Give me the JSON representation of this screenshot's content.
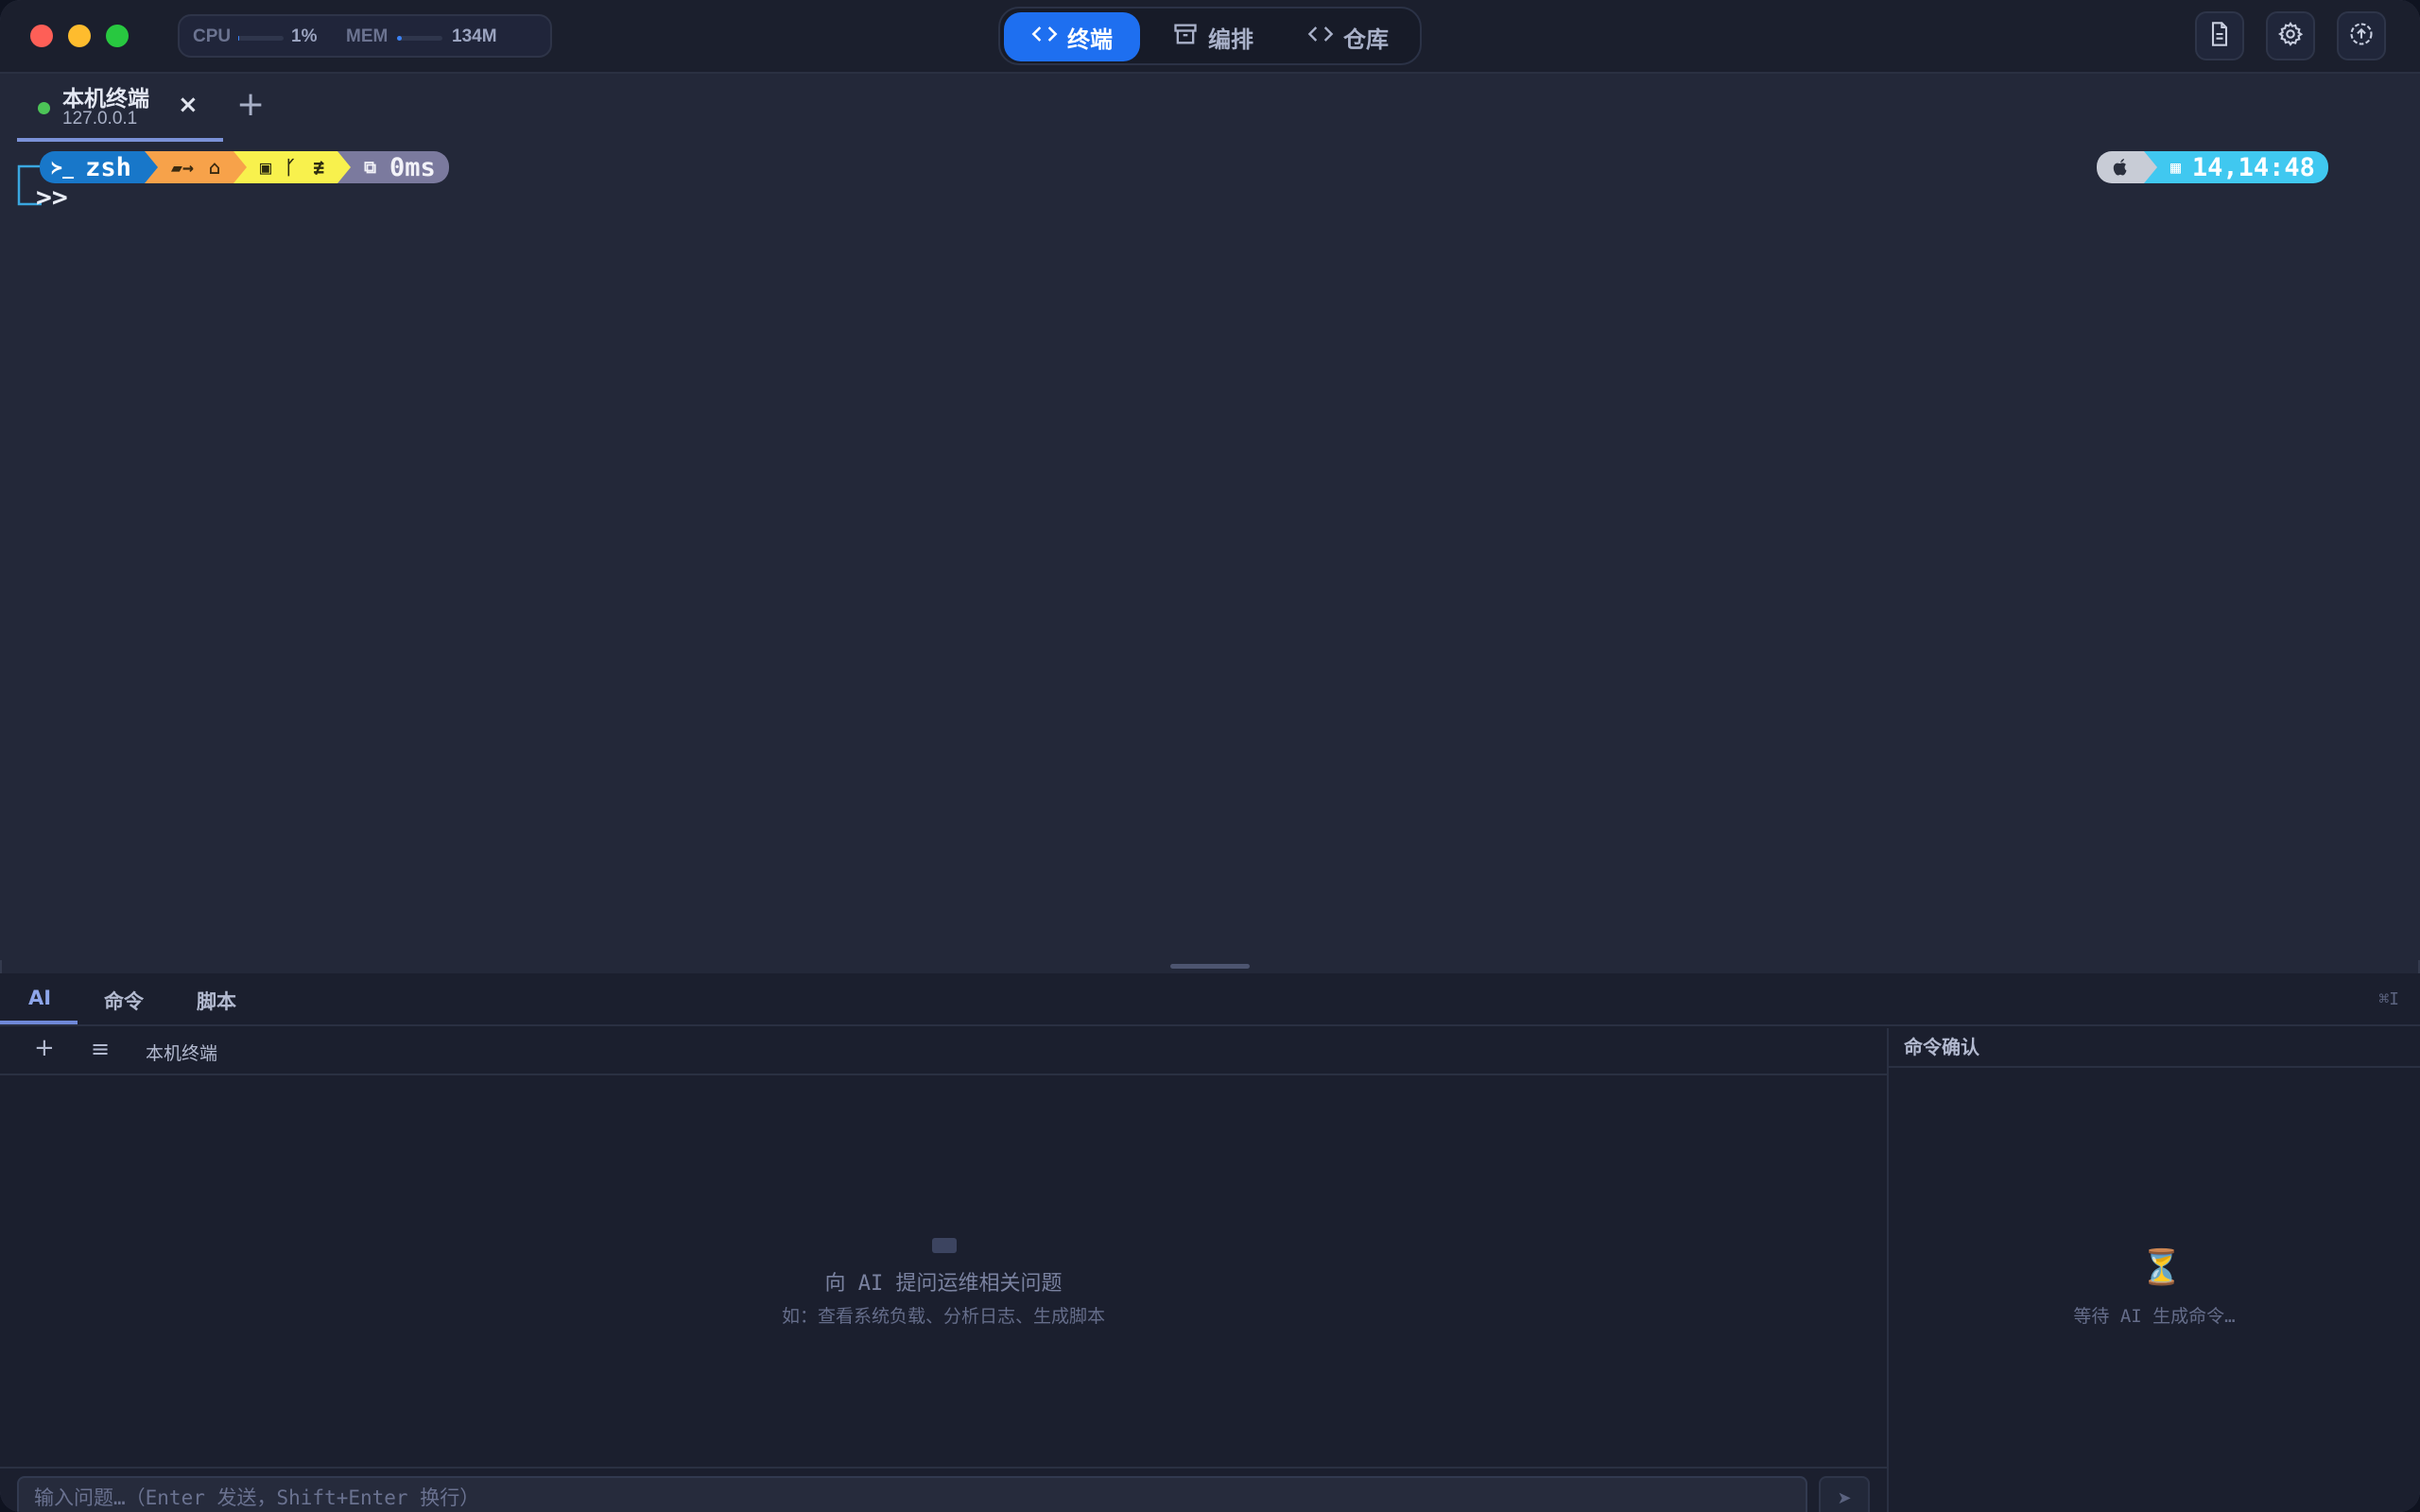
{
  "window": {
    "stats": {
      "cpu_label": "CPU",
      "cpu_value": "1%",
      "mem_label": "MEM",
      "mem_value": "134M"
    }
  },
  "nav": {
    "items": [
      {
        "label": "终端",
        "icon": "code-icon",
        "active": true
      },
      {
        "label": "编排",
        "icon": "archive-icon",
        "active": false
      },
      {
        "label": "仓库",
        "icon": "code-icon",
        "active": false
      }
    ]
  },
  "toolbar": {
    "icons": [
      "document-icon",
      "gear-icon",
      "upload-icon"
    ]
  },
  "tabs": {
    "items": [
      {
        "name": "本机终端",
        "host": "127.0.0.1",
        "status_color": "#4cc457"
      }
    ],
    "close": "×",
    "add": "+"
  },
  "prompt": {
    "shell": "zsh",
    "duration": "0ms",
    "time": "14,14:48",
    "cursor": ">>",
    "colors": {
      "shell_bg": "#1877c9",
      "dir_bg": "#f7a24a",
      "git_bg": "#f8f14d",
      "time_bg": "#40c8f0",
      "os_bg": "#c8ccd6"
    }
  },
  "panel": {
    "tabs": [
      "AI",
      "命令",
      "脚本"
    ],
    "active_tab": "AI",
    "shortcut": "⌘I",
    "session_add": "+",
    "session_menu": "≡",
    "session_name": "本机终端",
    "empty_title": "向 AI 提问运维相关问题",
    "empty_hint": "如：查看系统负载、分析日志、生成脚本",
    "input_placeholder": "输入问题…（Enter 发送，Shift+Enter 换行）",
    "send": "➤",
    "confirm_title": "命令确认",
    "confirm_wait": "等待 AI 生成命令…",
    "confirm_icon": "⏳"
  }
}
